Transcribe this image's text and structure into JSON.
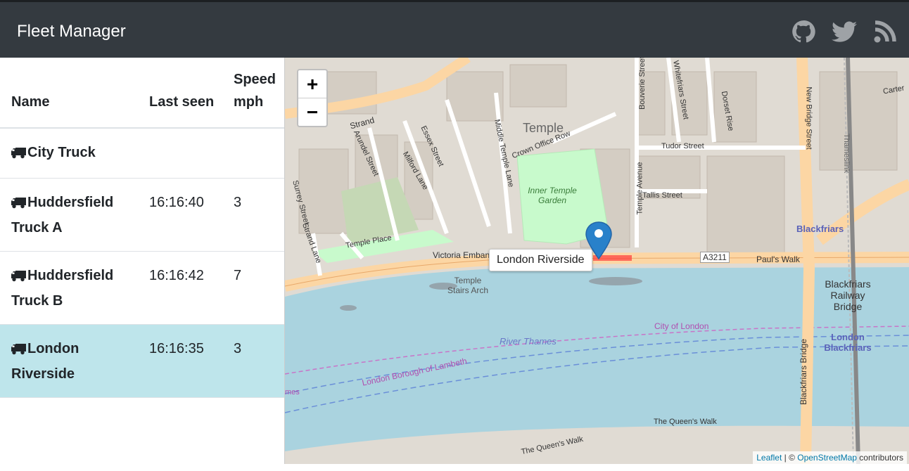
{
  "app": {
    "title": "Fleet Manager"
  },
  "nav": {
    "icons": [
      "github-icon",
      "twitter-icon",
      "rss-icon"
    ]
  },
  "table": {
    "headers": {
      "name": "Name",
      "last_seen": "Last seen",
      "speed": "Speed mph"
    },
    "rows": [
      {
        "name": "City Truck",
        "last_seen": "",
        "speed": ""
      },
      {
        "name": "Huddersfield Truck A",
        "last_seen": "16:16:40",
        "speed": "3"
      },
      {
        "name": "Huddersfield Truck B",
        "last_seen": "16:16:42",
        "speed": "7"
      },
      {
        "name": "London Riverside",
        "last_seen": "16:16:35",
        "speed": "3"
      }
    ]
  },
  "map": {
    "zoom_in": "+",
    "zoom_out": "−",
    "tooltip": "London Riverside",
    "attribution": {
      "leaflet": "Leaflet",
      "separator": " | © ",
      "osm": "OpenStreetMap",
      "suffix": " contributors"
    },
    "labels": {
      "temple": "Temple",
      "inner_temple_garden": "Inner Temple Garden",
      "victoria_embankment": "Victoria Embankment",
      "river_thames": "River Thames",
      "city_of_london": "City of London",
      "lambeth": "London Borough of Lambeth",
      "blackfriars": "Blackfriars",
      "blackfriars_railway_bridge": "Blackfriars Railway Bridge",
      "london_blackfriars": "London Blackfriars",
      "blackfriars_bridge": "Blackfriars Bridge",
      "a3211": "A3211",
      "pauls_walk": "Paul's Walk",
      "tudor_street": "Tudor Street",
      "tallis_street": "Tallis Street",
      "temple_place": "Temple Place",
      "strand": "Strand",
      "queens_walk": "The Queen's Walk",
      "queens_walk_2": "The Queen's Walk",
      "temple_stairs_arch": "Temple Stairs Arch",
      "crown_office_row": "Crown Office Row",
      "essex_street": "Essex Street",
      "arundel_street": "Arundel Street",
      "milford_lane": "Milford Lane",
      "middle_temple_lane": "Middle Temple Lane",
      "temple_avenue": "Temple Avenue",
      "bouverie_street": "Bouverie Street",
      "whitefriars_street": "Whitefriars Street",
      "dorset_rise": "Dorset Rise",
      "new_bridge_street": "New Bridge Street",
      "surrey_street": "Surrey Street",
      "strand_lane": "Strand Lane",
      "thameslink": "Thameslink",
      "carter": "Carter",
      "mes": "mes"
    }
  },
  "colors": {
    "navbar": "#343a40",
    "active_row": "#bee5eb",
    "water": "#aad3df",
    "road_main": "#fcd6a4",
    "park": "#c8facc",
    "marker": "#2981ca"
  }
}
